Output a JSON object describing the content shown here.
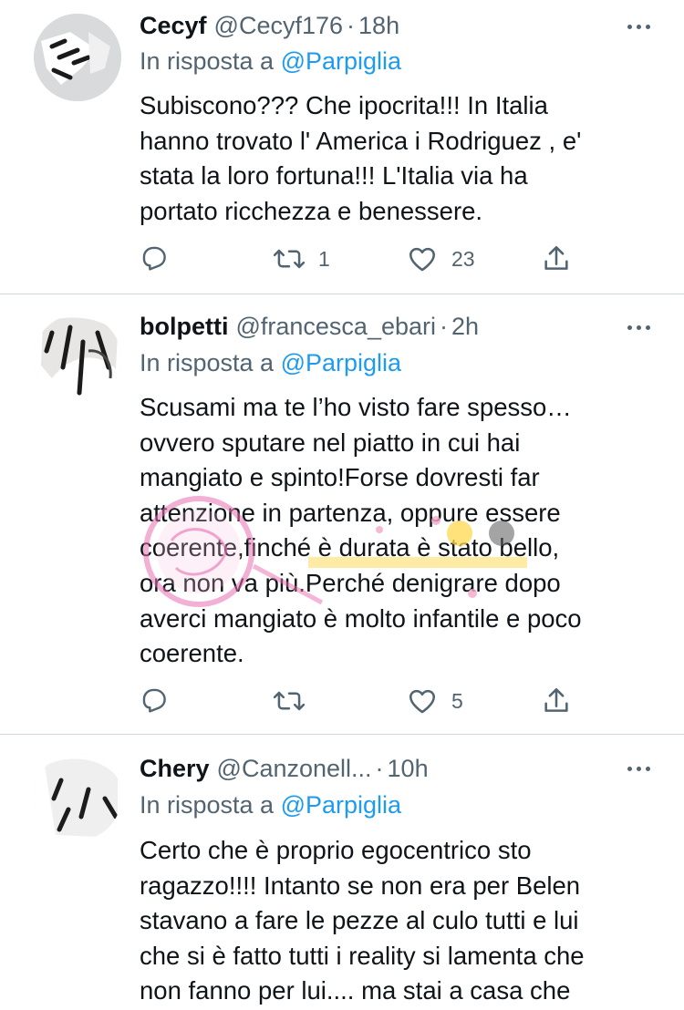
{
  "tweets": [
    {
      "name": "Cecyf",
      "handle": "@Cecyf176",
      "separator": "·",
      "time": "18h",
      "reply_prefix": "In risposta a",
      "reply_mention": "@Parpiglia",
      "lines": [
        "Subiscono??? Che ipocrita!!! In Italia",
        "hanno trovato l' America i Rodriguez , e'",
        "stata la loro fortuna!!! L'Italia via ha",
        "portato ricchezza e benessere."
      ],
      "reply_count": "",
      "retweet_count": "1",
      "like_count": "23"
    },
    {
      "name": "bolpetti",
      "handle": "@francesca_ebari",
      "separator": "·",
      "time": "2h",
      "reply_prefix": "In risposta a",
      "reply_mention": "@Parpiglia",
      "lines": [
        "Scusami ma te l’ho visto fare spesso…",
        "ovvero sputare nel piatto in cui hai",
        "mangiato e spinto!Forse dovresti  far",
        "attenzione in partenza, oppure essere",
        "coerente,finché è durata è stato bello,",
        "ora non va più.Perché denigrare dopo",
        "averci mangiato è molto infantile e poco",
        "coerente."
      ],
      "reply_count": "",
      "retweet_count": "",
      "like_count": "5"
    },
    {
      "name": "Chery",
      "handle": "@Canzonell...",
      "separator": "·",
      "time": "10h",
      "reply_prefix": "In risposta a",
      "reply_mention": "@Parpiglia",
      "lines": [
        "Certo che è proprio egocentrico sto",
        "ragazzo!!!! Intanto se non era per Belen",
        "stavano a fare le pezze al culo tutti e lui",
        "che si è fatto tutti i reality si lamenta che",
        "non fanno per lui.... ma stai a casa che"
      ]
    }
  ],
  "icons": {
    "reply": "reply-icon",
    "retweet": "retweet-icon",
    "like": "heart-icon",
    "share": "share-icon",
    "more": "more-icon"
  },
  "colors": {
    "text": "#0f1419",
    "secondary": "#536471",
    "mention": "#1d9bf0",
    "divider": "#cfd9de",
    "watermark": "#e86fb0"
  }
}
